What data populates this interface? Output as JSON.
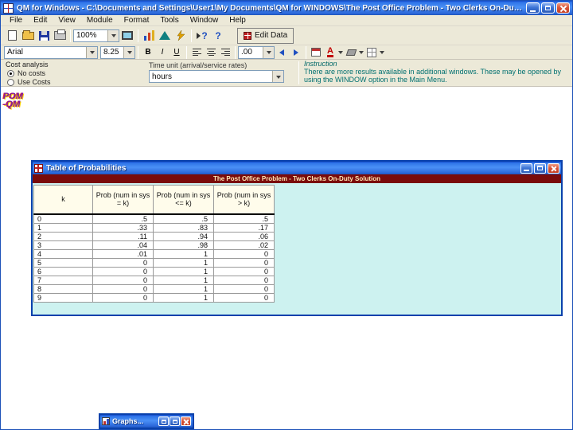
{
  "app": {
    "title": "QM for Windows - C:\\Documents and Settings\\User1\\My Documents\\QM for WINDOWS\\The Post Office Problem - Two Clerks On-Duty.wai"
  },
  "menu": {
    "items": [
      "File",
      "Edit",
      "View",
      "Module",
      "Format",
      "Tools",
      "Window",
      "Help"
    ]
  },
  "toolbar": {
    "zoom_value": "100%",
    "context_help_label": "?",
    "help_label": "?",
    "edit_data_label": "Edit Data"
  },
  "format_bar": {
    "font_name": "Arial",
    "font_size": "8.25",
    "bold": "B",
    "italic": "I",
    "underline": "U",
    "decimal_format": ".00",
    "font_color_label": "A"
  },
  "params": {
    "cost_analysis_label": "Cost analysis",
    "options": [
      {
        "label": "No costs",
        "selected": true
      },
      {
        "label": "Use Costs",
        "selected": false
      }
    ],
    "time_unit_label": "Time unit (arrival/service rates)",
    "time_unit_value": "hours",
    "instruction_title": "Instruction",
    "instruction_text": "There are more results available in additional windows. These may be opened by using the WINDOW option in the Main Menu."
  },
  "logo": {
    "line1": "POM",
    "line2": "-QM"
  },
  "results_window": {
    "title": "Table of Probabilities",
    "subtitle": "The Post Office Problem - Two Clerks On-Duty Solution",
    "table": {
      "headers": [
        "k",
        "Prob (num in sys = k)",
        "Prob (num in sys <= k)",
        "Prob (num in sys > k)"
      ],
      "rows": [
        [
          "0",
          ".5",
          ".5",
          ".5"
        ],
        [
          "1",
          ".33",
          ".83",
          ".17"
        ],
        [
          "2",
          ".11",
          ".94",
          ".06"
        ],
        [
          "3",
          ".04",
          ".98",
          ".02"
        ],
        [
          "4",
          ".01",
          "1",
          "0"
        ],
        [
          "5",
          "0",
          "1",
          "0"
        ],
        [
          "6",
          "0",
          "1",
          "0"
        ],
        [
          "7",
          "0",
          "1",
          "0"
        ],
        [
          "8",
          "0",
          "1",
          "0"
        ],
        [
          "9",
          "0",
          "1",
          "0"
        ]
      ]
    }
  },
  "graphs_window": {
    "title": "Graphs..."
  }
}
